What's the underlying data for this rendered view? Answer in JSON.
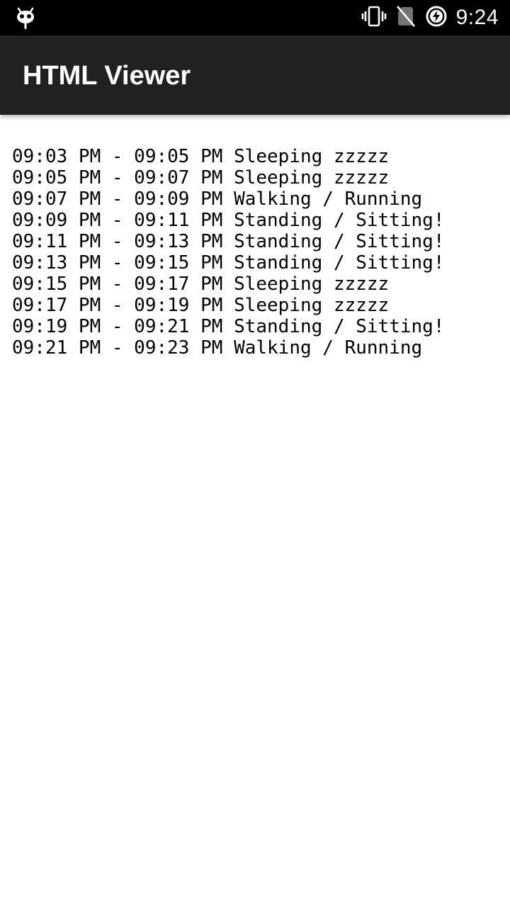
{
  "status_bar": {
    "time": "9:24",
    "icons": [
      "android-cat-icon",
      "vibrate-icon",
      "no-sim-icon",
      "battery-charging-icon"
    ]
  },
  "app_bar": {
    "title": "HTML Viewer"
  },
  "log": {
    "lines": [
      "09:03 PM - 09:05 PM Sleeping zzzzz",
      "09:05 PM - 09:07 PM Sleeping zzzzz",
      "09:07 PM - 09:09 PM Walking / Running",
      "09:09 PM - 09:11 PM Standing / Sitting!",
      "09:11 PM - 09:13 PM Standing / Sitting!",
      "09:13 PM - 09:15 PM Standing / Sitting!",
      "09:15 PM - 09:17 PM Sleeping zzzzz",
      "09:17 PM - 09:19 PM Sleeping zzzzz",
      "09:19 PM - 09:21 PM Standing / Sitting!",
      "09:21 PM - 09:23 PM Walking / Running"
    ]
  },
  "colors": {
    "status_bar_bg": "#000000",
    "app_bar_bg": "#212121",
    "content_bg": "#ffffff",
    "text": "#000000"
  }
}
